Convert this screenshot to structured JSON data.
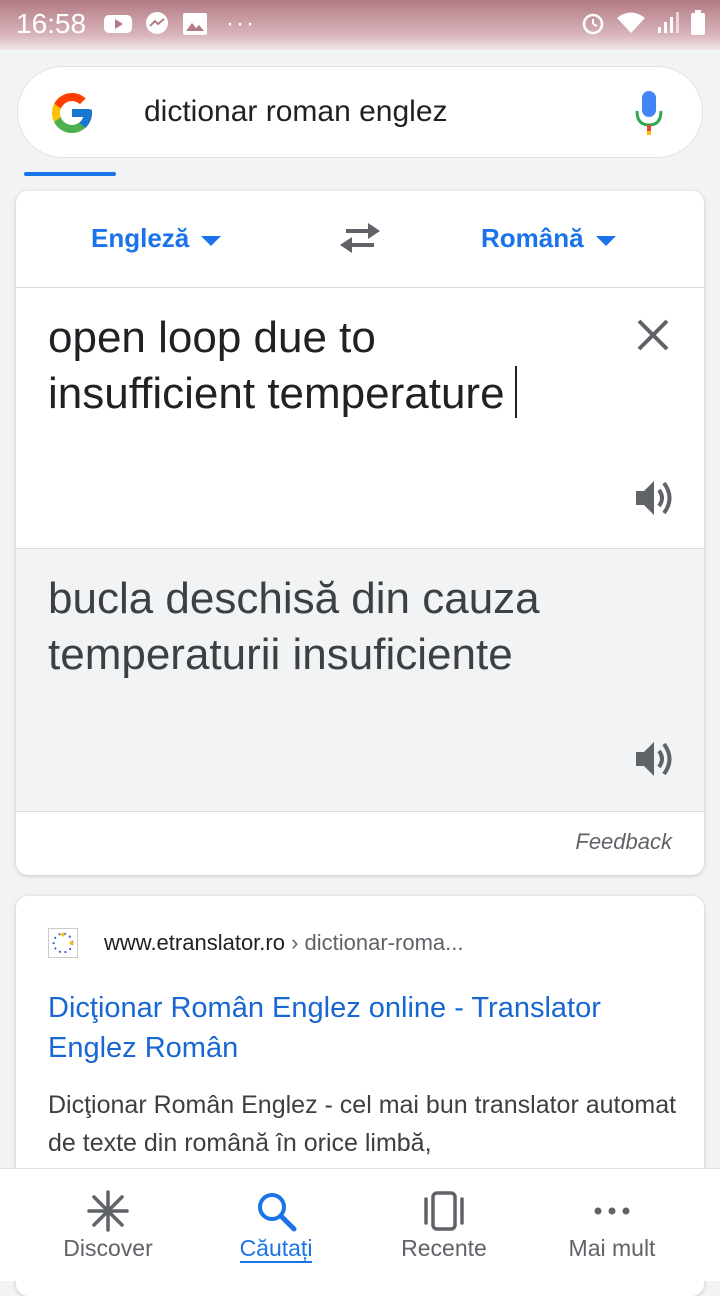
{
  "status_bar": {
    "time": "16:58",
    "left_icons": [
      "youtube-icon",
      "messenger-icon",
      "gallery-icon",
      "more-dots-icon"
    ],
    "right_icons": [
      "alarm-icon",
      "wifi-icon",
      "signal-icon",
      "battery-icon"
    ]
  },
  "search": {
    "query": "dictionar roman englez"
  },
  "translate": {
    "source_lang": "Engleză",
    "target_lang": "Română",
    "source_text": "open loop due to insufficient temperature",
    "target_text": "bucla deschisă din cauza temperaturii insuficiente",
    "feedback_label": "Feedback"
  },
  "result": {
    "site": "www.etranslator.ro",
    "path": " › dictionar-roma...",
    "title": "Dicţionar Român Englez online - Translator Englez Român",
    "snippet": "Dicţionar Român Englez - cel mai bun translator automat de texte din română în orice limbă,"
  },
  "bottom_nav": {
    "items": [
      {
        "label": "Discover",
        "icon": "asterisk-icon"
      },
      {
        "label": "Căutați",
        "icon": "search-icon"
      },
      {
        "label": "Recente",
        "icon": "recent-cards-icon"
      },
      {
        "label": "Mai mult",
        "icon": "more-dots-icon"
      }
    ],
    "active": "Căutați"
  },
  "colors": {
    "accent": "#1a73e8",
    "link": "#1967d2",
    "status_bar": "#b37b84"
  }
}
